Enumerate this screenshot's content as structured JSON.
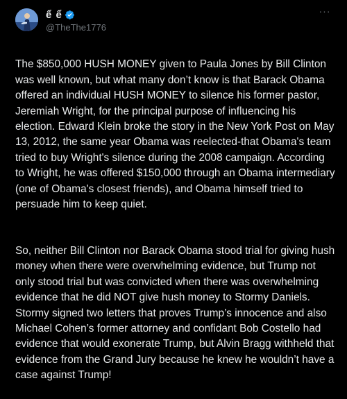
{
  "tweet": {
    "display_name": "ể ể",
    "handle": "@TheThe1776",
    "more_label": "···",
    "paragraphs": [
      "The $850,000 HUSH MONEY given to Paula Jones by Bill Clinton was well known, but what many don’t know is that Barack Obama offered an individual HUSH MONEY to silence his former pastor, Jeremiah Wright, for the principal purpose of influencing his election.  Edward Klein broke the story in the New York Post on May 13, 2012, the same year Obama was reelected-that Obama's team tried to buy Wright's silence during the 2008 campaign. According to Wright, he was offered $150,000 through an Obama intermediary (one of Obama's closest friends), and Obama himself tried to persuade him to keep quiet.",
      "So, neither Bill Clinton nor Barack Obama stood trial for giving hush money when there were overwhelming evidence, but Trump not only stood trial but was convicted when there was overwhelming evidence that he did NOT give hush money to Stormy Daniels.  Stormy signed two letters that proves Trump’s innocence and also Michael Cohen’s former attorney and confidant Bob Costello had evidence that would exonerate Trump, but Alvin Bragg withheld that evidence from the Grand Jury because he knew he wouldn’t have a case against Trump!"
    ]
  },
  "icons": {
    "avatar": "avatar-image",
    "verified": "verified-badge-icon",
    "more": "more-options-icon"
  },
  "colors": {
    "background": "#000000",
    "text": "#e7e9ea",
    "muted": "#71767b",
    "verified": "#1d9bf0"
  }
}
